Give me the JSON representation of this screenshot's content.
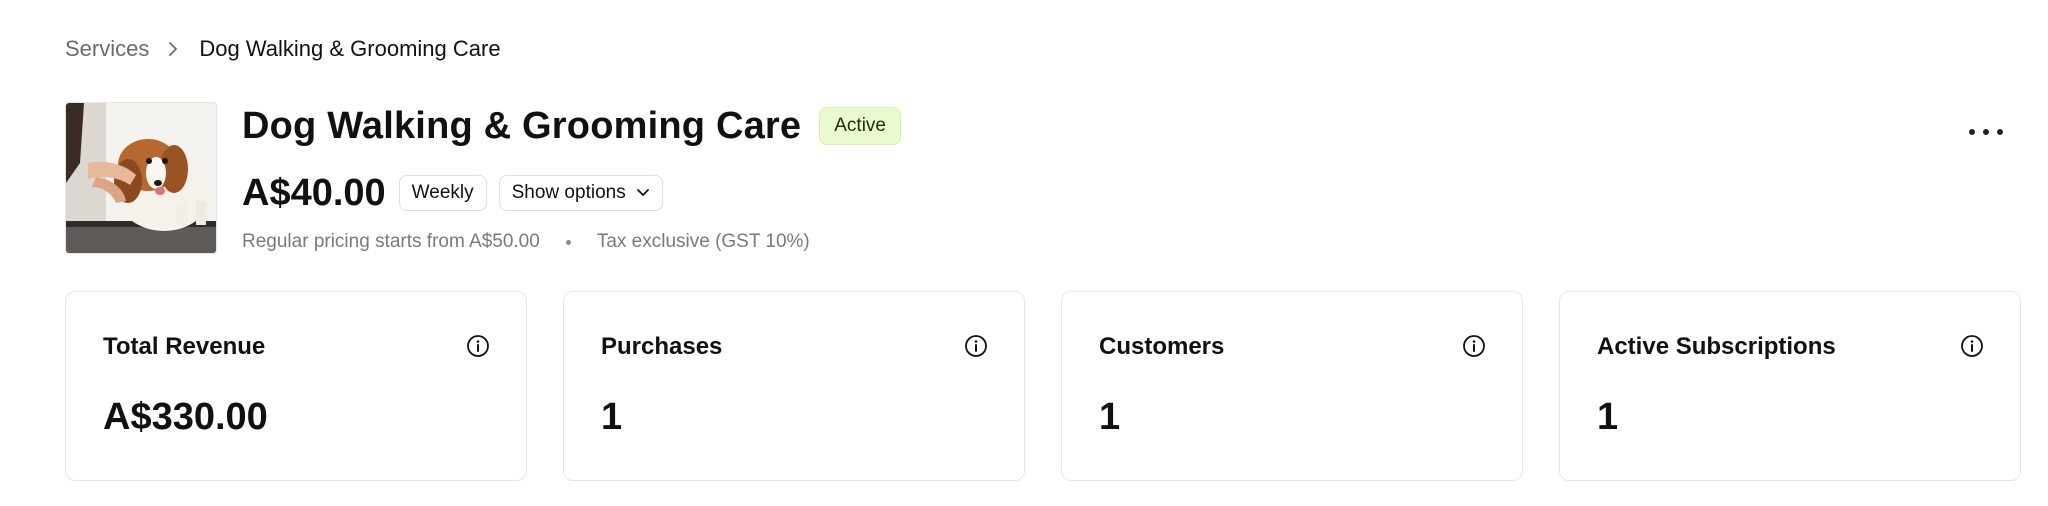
{
  "breadcrumb": {
    "parent": "Services",
    "current": "Dog Walking & Grooming Care"
  },
  "product": {
    "title": "Dog Walking & Grooming Care",
    "status": "Active",
    "price": "A$40.00",
    "interval": "Weekly",
    "options_label": "Show options",
    "regular_pricing": "Regular pricing starts from A$50.00",
    "tax_note": "Tax exclusive (GST 10%)",
    "image_icon": "dog-grooming-photo"
  },
  "menu": {
    "more_icon": "ellipsis-horizontal-icon"
  },
  "stats": [
    {
      "label": "Total Revenue",
      "value": "A$330.00",
      "icon": "info-icon"
    },
    {
      "label": "Purchases",
      "value": "1",
      "icon": "info-icon"
    },
    {
      "label": "Customers",
      "value": "1",
      "icon": "info-icon"
    },
    {
      "label": "Active Subscriptions",
      "value": "1",
      "icon": "info-icon"
    }
  ],
  "colors": {
    "status_badge_bg": "#eafbd0",
    "text_primary": "#111111",
    "text_muted": "#7a7a7a",
    "border": "#e6e6e6"
  }
}
